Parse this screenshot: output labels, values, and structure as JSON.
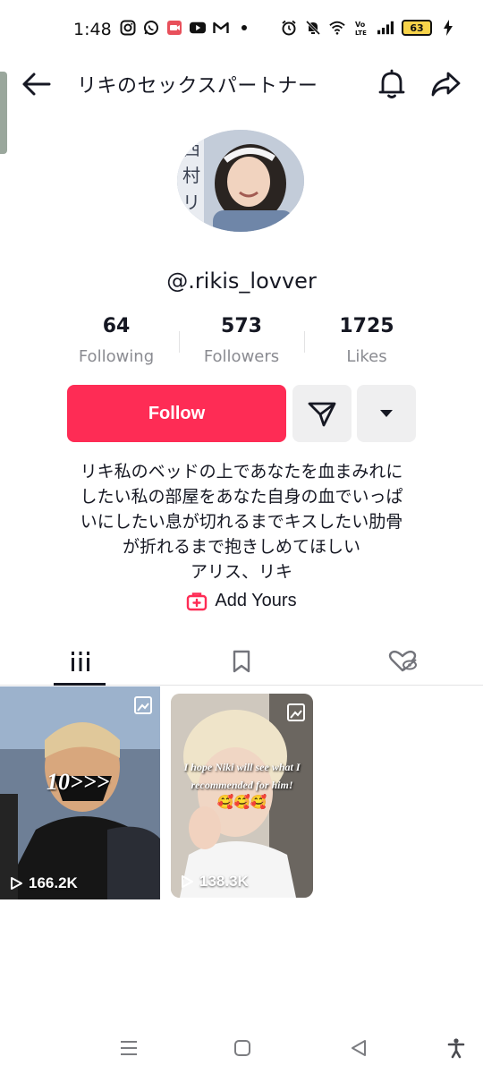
{
  "status_bar": {
    "time": "1:48",
    "battery": "63",
    "left_icons": [
      "instagram-icon",
      "whatsapp-icon",
      "screen-record-icon",
      "youtube-icon",
      "gmail-icon",
      "dot-icon"
    ],
    "right_icons": [
      "alarm-icon",
      "mute-icon",
      "wifi-icon",
      "volte-icon",
      "signal-icon",
      "battery-icon",
      "charging-icon"
    ]
  },
  "header": {
    "title": "リキのセックスパートナー"
  },
  "profile": {
    "username": "@.rikis_lovver",
    "stats": [
      {
        "value": "64",
        "label": "Following"
      },
      {
        "value": "573",
        "label": "Followers"
      },
      {
        "value": "1725",
        "label": "Likes"
      }
    ]
  },
  "actions": {
    "follow_label": "Follow"
  },
  "bio": {
    "lines": [
      "リキ私のベッドの上であなたを血まみれに",
      "したい私の部屋をあなた自身の血でいっぱ",
      "いにしたい息が切れるまでキスしたい肋骨",
      "が折れるまで抱きしめてほしい",
      "アリス、リキ"
    ]
  },
  "add_yours": {
    "label": "Add Yours"
  },
  "tabs": [
    {
      "name": "videos",
      "icon": "grid-icon",
      "active": true
    },
    {
      "name": "favorites",
      "icon": "bookmark-icon",
      "active": false
    },
    {
      "name": "liked",
      "icon": "hidden-heart-icon",
      "active": false
    }
  ],
  "videos": [
    {
      "views": "166.2K",
      "caption": "10>>>",
      "pinned": true
    },
    {
      "views": "138.3K",
      "caption": "I hope Niki will see what I recommended for him!",
      "emoji": "🥰🥰🥰",
      "pinned": true
    }
  ],
  "colors": {
    "accent": "#fe2c55",
    "button_gray": "#efeff0",
    "muted_text": "#8a8b91"
  }
}
